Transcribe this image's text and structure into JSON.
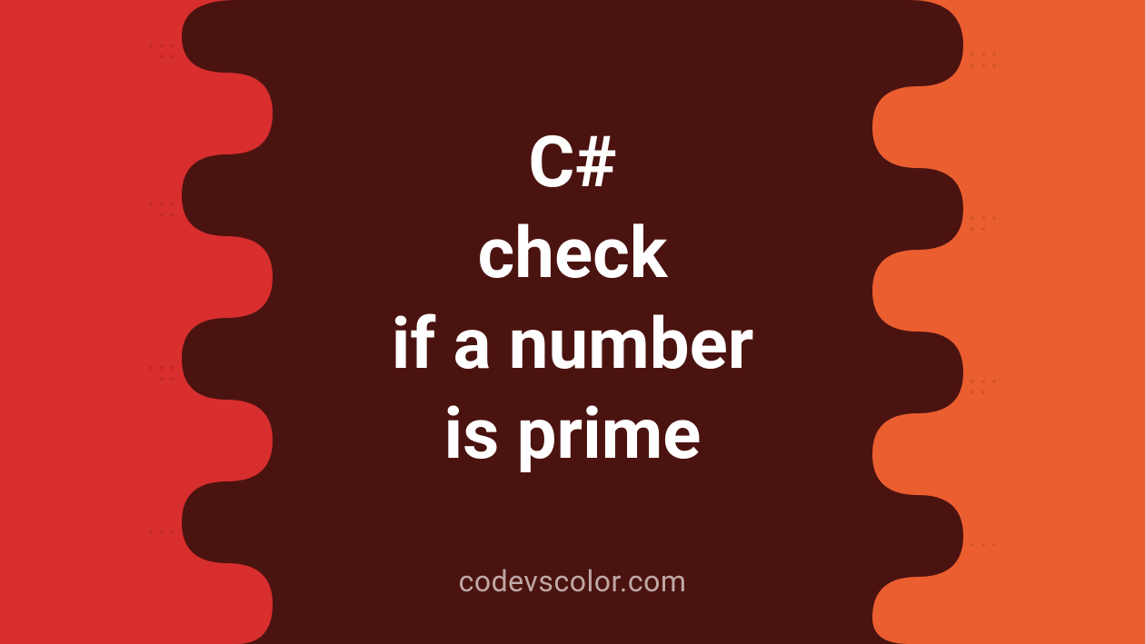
{
  "colors": {
    "red": "#d82e2e",
    "orange": "#eb5e30",
    "maroon": "#4b1310",
    "text": "#ffffff",
    "credit": "#bfa9a7"
  },
  "title": {
    "line1": "C#",
    "line2": "check",
    "line3": "if a number",
    "line4": "is prime"
  },
  "credit": "codevscolor.com"
}
